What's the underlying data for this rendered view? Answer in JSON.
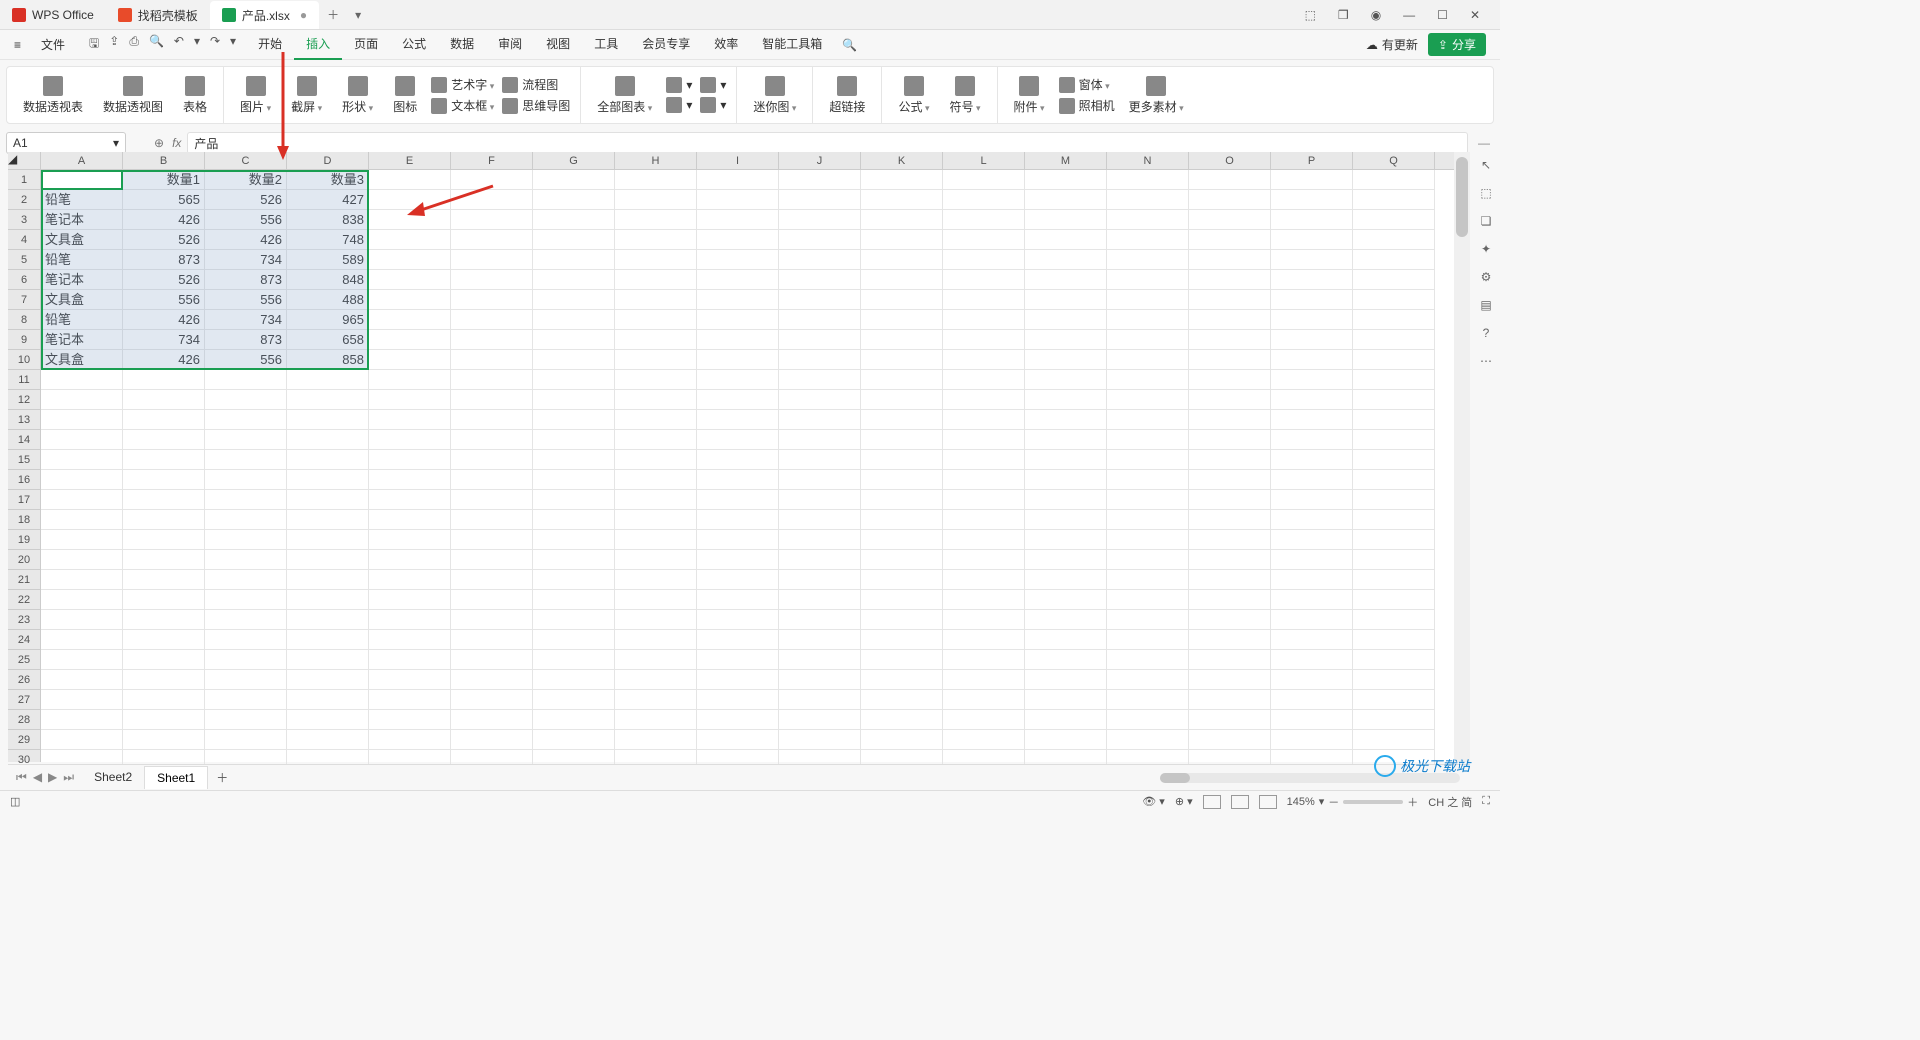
{
  "app_name": "WPS Office",
  "title_tabs": [
    {
      "icon": "icon-w",
      "label": "WPS Office",
      "dirty": false,
      "active": false
    },
    {
      "icon": "icon-d",
      "label": "找稻壳模板",
      "dirty": false,
      "active": false
    },
    {
      "icon": "icon-s",
      "label": "产品.xlsx",
      "dirty": true,
      "active": true
    }
  ],
  "win_controls": {
    "box": "⬚",
    "cube": "❒",
    "user": "◉",
    "min": "—",
    "max": "☐",
    "close": "✕"
  },
  "file_menu": "文件",
  "qat": {
    "save": "🖫",
    "export": "⇪",
    "print": "⎙",
    "preview": "🔍",
    "undo": "↶",
    "undo_d": "▾",
    "redo": "↷",
    "redo_d": "▾"
  },
  "menus": [
    "开始",
    "插入",
    "页面",
    "公式",
    "数据",
    "审阅",
    "视图",
    "工具",
    "会员专享",
    "效率",
    "智能工具箱"
  ],
  "active_menu": "插入",
  "update_label": "有更新",
  "share_label": "分享",
  "ribbon": {
    "g1": {
      "pivot_table": "数据透视表",
      "pivot_chart": "数据透视图",
      "table": "表格"
    },
    "g2": {
      "pic": "图片",
      "shot": "截屏",
      "shape": "形状",
      "icon": "图标",
      "art": "艺术字",
      "textbox": "文本框",
      "flow": "流程图",
      "mind": "思维导图"
    },
    "g3": {
      "allchart": "全部图表",
      "col": "",
      "bar": "",
      "line": ""
    },
    "g4": {
      "spark": "迷你图"
    },
    "g5": {
      "link": "超链接"
    },
    "g6": {
      "formula": "公式",
      "symbol": "符号"
    },
    "g7": {
      "attach": "附件",
      "window": "窗体",
      "camera": "照相机",
      "more": "更多素材"
    }
  },
  "name_box": "A1",
  "formula_value": "产品",
  "fx_label": "fx",
  "columns": [
    "A",
    "B",
    "C",
    "D",
    "E",
    "F",
    "G",
    "H",
    "I",
    "J",
    "K",
    "L",
    "M",
    "N",
    "O",
    "P",
    "Q"
  ],
  "row_count": 30,
  "chart_data": {
    "type": "table",
    "headers": [
      "产品",
      "数量1",
      "数量2",
      "数量3"
    ],
    "rows": [
      [
        "铅笔",
        565,
        526,
        427
      ],
      [
        "笔记本",
        426,
        556,
        838
      ],
      [
        "文具盒",
        526,
        426,
        748
      ],
      [
        "铅笔",
        873,
        734,
        589
      ],
      [
        "笔记本",
        526,
        873,
        848
      ],
      [
        "文具盒",
        556,
        556,
        488
      ],
      [
        "铅笔",
        426,
        734,
        965
      ],
      [
        "笔记本",
        734,
        873,
        658
      ],
      [
        "文具盒",
        426,
        556,
        858
      ]
    ]
  },
  "sheets": [
    "Sheet2",
    "Sheet1"
  ],
  "active_sheet": "Sheet1",
  "status": {
    "zoom": "145%",
    "ime": "CH 之 简"
  },
  "watermark": "极光下载站"
}
